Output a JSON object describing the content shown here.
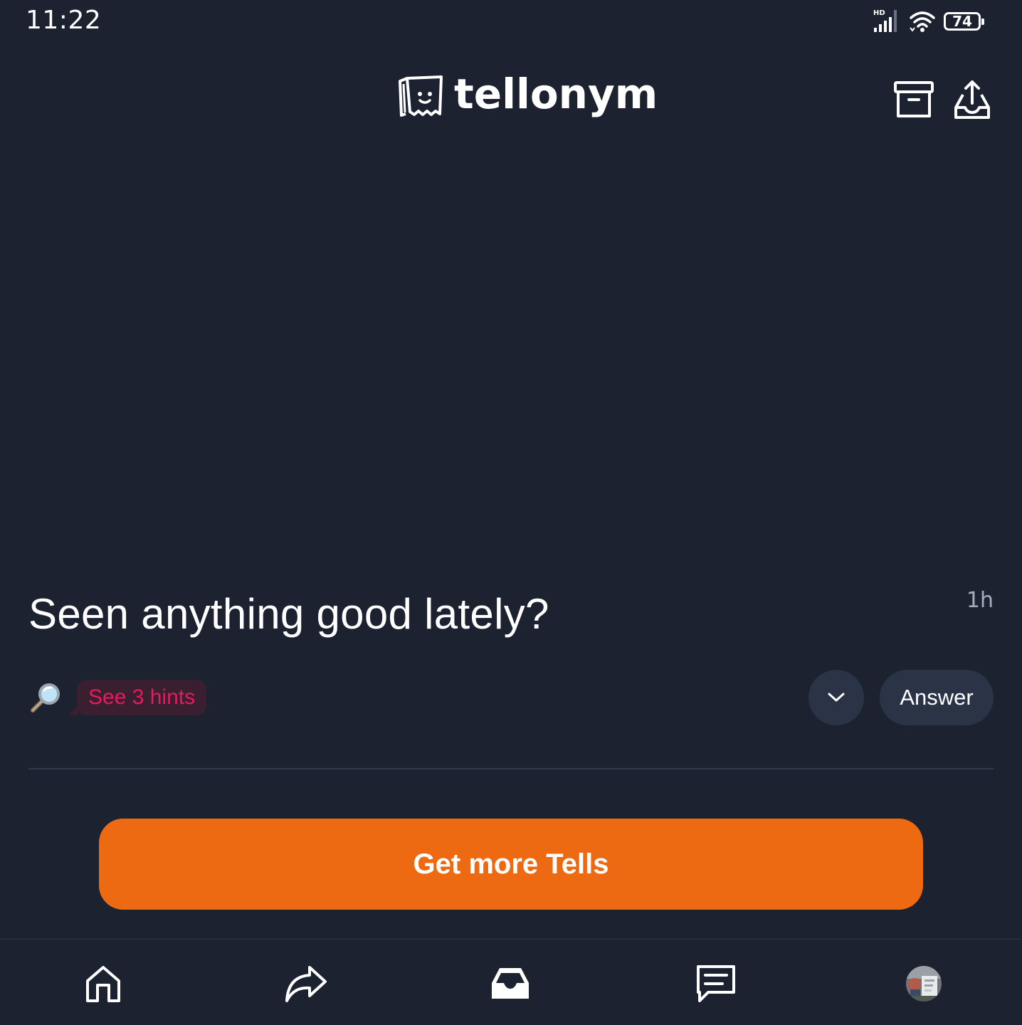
{
  "status_bar": {
    "time": "11:22",
    "network_label": "HD",
    "battery_level": "74"
  },
  "header": {
    "app_name": "tellonym"
  },
  "tell": {
    "question": "Seen anything good lately?",
    "timestamp": "1h",
    "hints_label": "See 3 hints",
    "answer_label": "Answer"
  },
  "cta": {
    "label": "Get more Tells"
  },
  "colors": {
    "background": "#1d2231",
    "accent": "#ed6912",
    "hint_text": "#e8195f",
    "pill_bg": "#2b3447"
  },
  "icons": {
    "header": [
      "logo-icon",
      "archive-icon",
      "outbox-icon"
    ],
    "nav": [
      "home-icon",
      "share-icon",
      "inbox-icon",
      "chat-icon",
      "avatar"
    ]
  }
}
